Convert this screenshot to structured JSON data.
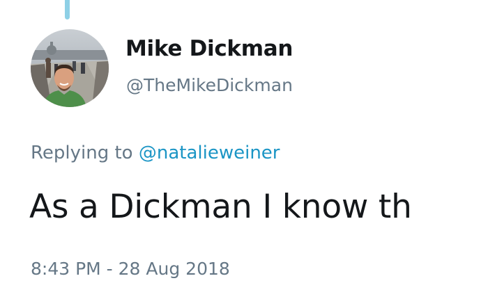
{
  "tweet": {
    "author": {
      "display_name": "Mike Dickman",
      "handle": "@TheMikeDickman",
      "avatar_icon": "profile-photo"
    },
    "replying_prefix": "Replying to",
    "replying_handle": "@natalieweiner",
    "text": "As a Dickman I know th",
    "timestamp": "8:43 PM - 28 Aug 2018"
  },
  "colors": {
    "primary_text": "#14171a",
    "secondary_text": "#657786",
    "link": "#1b95c5",
    "thread_line": "#8ed0e6"
  }
}
